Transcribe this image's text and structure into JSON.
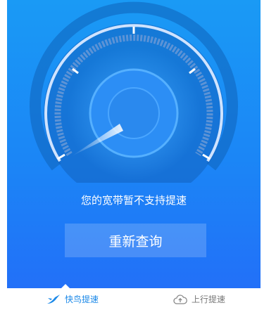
{
  "status": {
    "message": "您的宽带暂不支持提速"
  },
  "actions": {
    "requery_label": "重新查询"
  },
  "tabs": [
    {
      "label": "快鸟提速",
      "icon": "bird-icon",
      "active": true
    },
    {
      "label": "上行提速",
      "icon": "cloud-upload-icon",
      "active": false
    }
  ],
  "colors": {
    "background_top": "#1a9af5",
    "background_bottom": "#2270f8",
    "active_tab": "#1a88e8",
    "inactive_tab": "#777777"
  }
}
